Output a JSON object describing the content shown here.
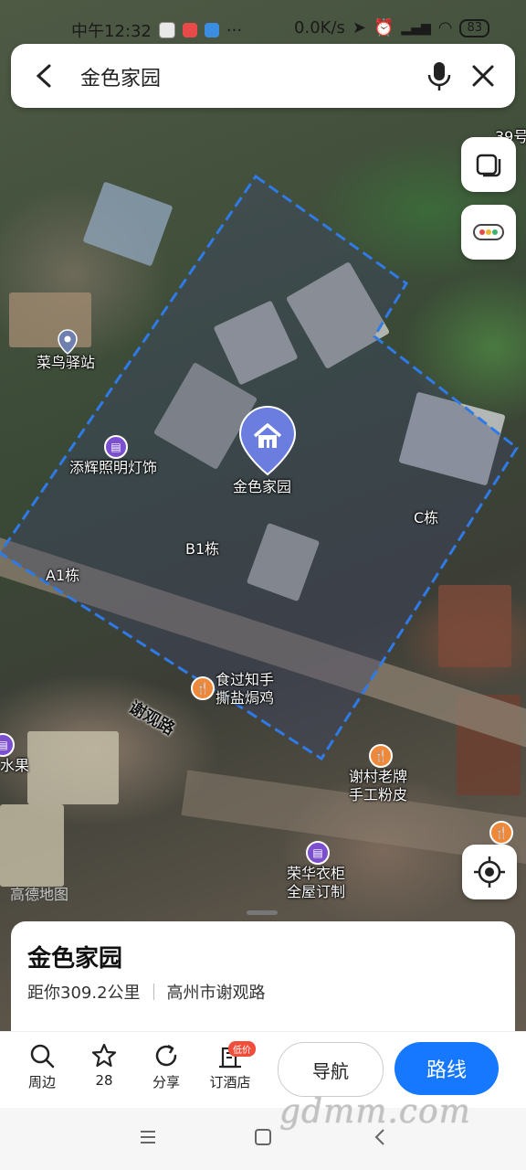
{
  "status_bar": {
    "time": "中午12:32",
    "network_speed": "0.0K/s",
    "battery": "83"
  },
  "search": {
    "query": "金色家园"
  },
  "map": {
    "house_number_label": "39号",
    "pois": [
      {
        "name": "菜鸟驿站",
        "icon": "location-pin-icon",
        "color": "#6f7fb0"
      },
      {
        "name": "添辉照明灯饰",
        "icon": "shop-icon",
        "color": "#7b4fd0"
      },
      {
        "name": "食过知手\n撕盐焗鸡",
        "icon": "restaurant-icon",
        "color": "#f0883a"
      },
      {
        "name": "谢村老牌\n手工粉皮",
        "icon": "restaurant-icon",
        "color": "#f0883a"
      },
      {
        "name": "荣华衣柜\n全屋订制",
        "icon": "shop-icon",
        "color": "#7b4fd0"
      },
      {
        "name": "水果",
        "icon": "shop-icon",
        "color": "#7b4fd0"
      }
    ],
    "building_labels": [
      "A1栋",
      "B1栋",
      "C栋"
    ],
    "main_poi": "金色家园",
    "road_name": "谢观路",
    "provider_watermark": "高德地图"
  },
  "place_card": {
    "title": "金色家园",
    "distance": "距你309.2公里",
    "address": "高州市谢观路"
  },
  "actions": [
    {
      "label": "周边",
      "icon": "search-icon"
    },
    {
      "label": "28",
      "icon": "star-icon"
    },
    {
      "label": "分享",
      "icon": "share-icon"
    },
    {
      "label": "订酒店",
      "icon": "hotel-icon",
      "badge": "低价"
    }
  ],
  "buttons": {
    "navigate": "导航",
    "route": "路线"
  },
  "site_watermark": "gdmm.com",
  "colors": {
    "accent": "#1677ff",
    "boundary": "#2f7ae5"
  }
}
